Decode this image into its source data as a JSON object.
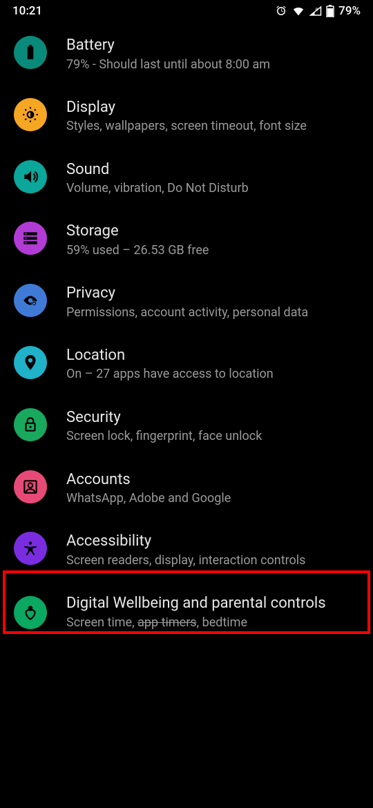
{
  "status": {
    "time": "10:21",
    "battery": "79%"
  },
  "colors": {
    "battery": "#0a8a7a",
    "display": "#f5a623",
    "sound": "#0aa79a",
    "storage": "#b23bd6",
    "privacy": "#3f7bd6",
    "location": "#1fb2c9",
    "security": "#18a85e",
    "accounts": "#e84a77",
    "accessibility": "#7a2de0",
    "wellbeing": "#0aa860"
  },
  "items": [
    {
      "key": "battery",
      "title": "Battery",
      "subtitle": "79% - Should last until about 8:00 am"
    },
    {
      "key": "display",
      "title": "Display",
      "subtitle": "Styles, wallpapers, screen timeout, font size"
    },
    {
      "key": "sound",
      "title": "Sound",
      "subtitle": "Volume, vibration, Do Not Disturb"
    },
    {
      "key": "storage",
      "title": "Storage",
      "subtitle": "59% used – 26.53 GB free"
    },
    {
      "key": "privacy",
      "title": "Privacy",
      "subtitle": "Permissions, account activity, personal data"
    },
    {
      "key": "location",
      "title": "Location",
      "subtitle": "On – 27 apps have access to location"
    },
    {
      "key": "security",
      "title": "Security",
      "subtitle": "Screen lock, fingerprint, face unlock"
    },
    {
      "key": "accounts",
      "title": "Accounts",
      "subtitle": "WhatsApp, Adobe and Google"
    },
    {
      "key": "accessibility",
      "title": "Accessibility",
      "subtitle": "Screen readers, display, interaction controls"
    },
    {
      "key": "wellbeing",
      "title": "Digital Wellbeing and parental controls",
      "subtitle_pre": "Screen time, ",
      "subtitle_strike": "app timers",
      "subtitle_post": ", bedtime"
    }
  ]
}
